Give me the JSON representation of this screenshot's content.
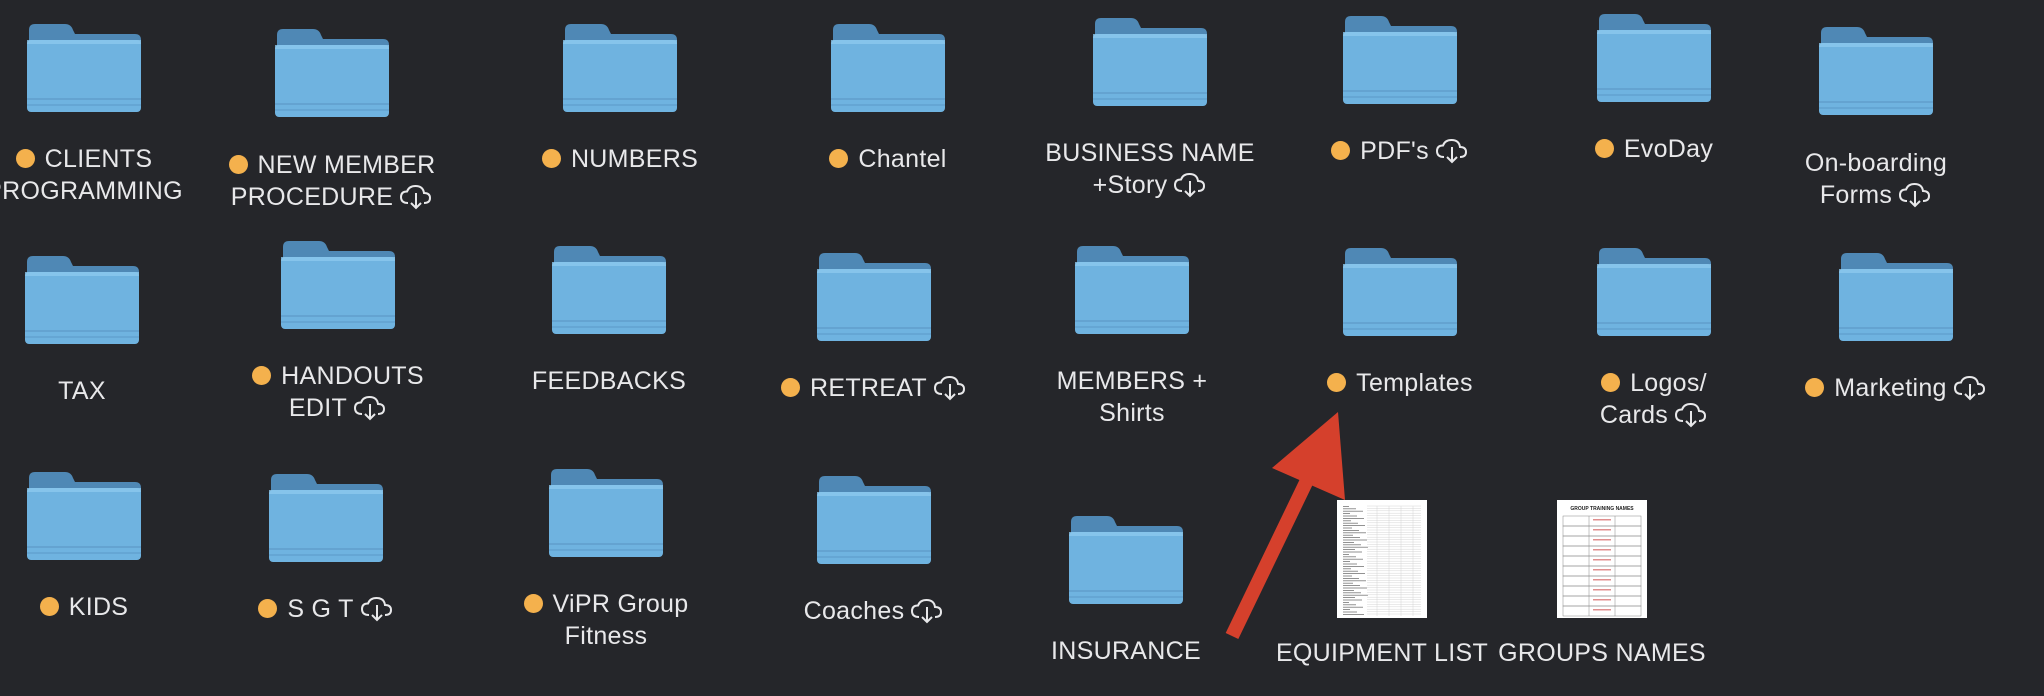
{
  "colors": {
    "background": "#25262a",
    "label_text": "#e8e8ea",
    "tag_orange": "#f4b14d",
    "folder_front": "#6fb3e0",
    "folder_back": "#4f88b5",
    "arrow": "#d5402c"
  },
  "icons": {
    "folder": "folder-icon",
    "cloud": "icloud-download-icon",
    "tag": "orange-tag-dot",
    "document": "document-thumbnail"
  },
  "items": [
    {
      "id": "clients-programming",
      "type": "folder",
      "tag": true,
      "cloud": false,
      "lines": [
        "CLIENTS",
        "PROGRAMMING"
      ]
    },
    {
      "id": "new-member-procedure",
      "type": "folder",
      "tag": true,
      "cloud": true,
      "lines": [
        "NEW MEMBER",
        "PROCEDURE"
      ]
    },
    {
      "id": "numbers",
      "type": "folder",
      "tag": true,
      "cloud": false,
      "lines": [
        "NUMBERS"
      ]
    },
    {
      "id": "chantel",
      "type": "folder",
      "tag": true,
      "cloud": false,
      "lines": [
        "Chantel"
      ]
    },
    {
      "id": "business-name-story",
      "type": "folder",
      "tag": false,
      "cloud": true,
      "lines": [
        "BUSINESS NAME",
        "+Story"
      ]
    },
    {
      "id": "pdfs",
      "type": "folder",
      "tag": true,
      "cloud": true,
      "lines": [
        "PDF's"
      ]
    },
    {
      "id": "evoday",
      "type": "folder",
      "tag": true,
      "cloud": false,
      "lines": [
        "EvoDay"
      ]
    },
    {
      "id": "on-boarding-forms",
      "type": "folder",
      "tag": false,
      "cloud": true,
      "lines": [
        "On-boarding",
        "Forms"
      ]
    },
    {
      "id": "tax",
      "type": "folder",
      "tag": false,
      "cloud": false,
      "lines": [
        "TAX"
      ]
    },
    {
      "id": "handouts-edit",
      "type": "folder",
      "tag": true,
      "cloud": true,
      "lines": [
        "HANDOUTS",
        "EDIT"
      ]
    },
    {
      "id": "feedbacks",
      "type": "folder",
      "tag": false,
      "cloud": false,
      "lines": [
        "FEEDBACKS"
      ]
    },
    {
      "id": "retreat",
      "type": "folder",
      "tag": true,
      "cloud": true,
      "lines": [
        "RETREAT"
      ]
    },
    {
      "id": "members-shirts",
      "type": "folder",
      "tag": false,
      "cloud": false,
      "lines": [
        "MEMBERS +",
        "Shirts"
      ]
    },
    {
      "id": "templates",
      "type": "folder",
      "tag": true,
      "cloud": false,
      "lines": [
        "Templates"
      ]
    },
    {
      "id": "logos-cards",
      "type": "folder",
      "tag": true,
      "cloud": true,
      "lines": [
        "Logos/",
        "Cards"
      ]
    },
    {
      "id": "marketing",
      "type": "folder",
      "tag": true,
      "cloud": true,
      "lines": [
        "Marketing"
      ]
    },
    {
      "id": "kids",
      "type": "folder",
      "tag": true,
      "cloud": false,
      "lines": [
        "KIDS"
      ]
    },
    {
      "id": "sgt",
      "type": "folder",
      "tag": true,
      "cloud": true,
      "lines": [
        "S G T"
      ]
    },
    {
      "id": "vipr-group-fitness",
      "type": "folder",
      "tag": true,
      "cloud": false,
      "lines": [
        "ViPR Group",
        "Fitness"
      ]
    },
    {
      "id": "coaches",
      "type": "folder",
      "tag": false,
      "cloud": true,
      "lines": [
        "Coaches"
      ]
    },
    {
      "id": "insurance",
      "type": "folder",
      "tag": false,
      "cloud": false,
      "lines": [
        "INSURANCE"
      ]
    },
    {
      "id": "equipment-list",
      "type": "document",
      "tag": false,
      "cloud": false,
      "lines": [
        "EQUIPMENT LIST"
      ]
    },
    {
      "id": "groups-names",
      "type": "document",
      "tag": false,
      "cloud": false,
      "lines": [
        "GROUPS NAMES"
      ],
      "thumb_title": "GROUP TRAINING NAMES"
    }
  ]
}
